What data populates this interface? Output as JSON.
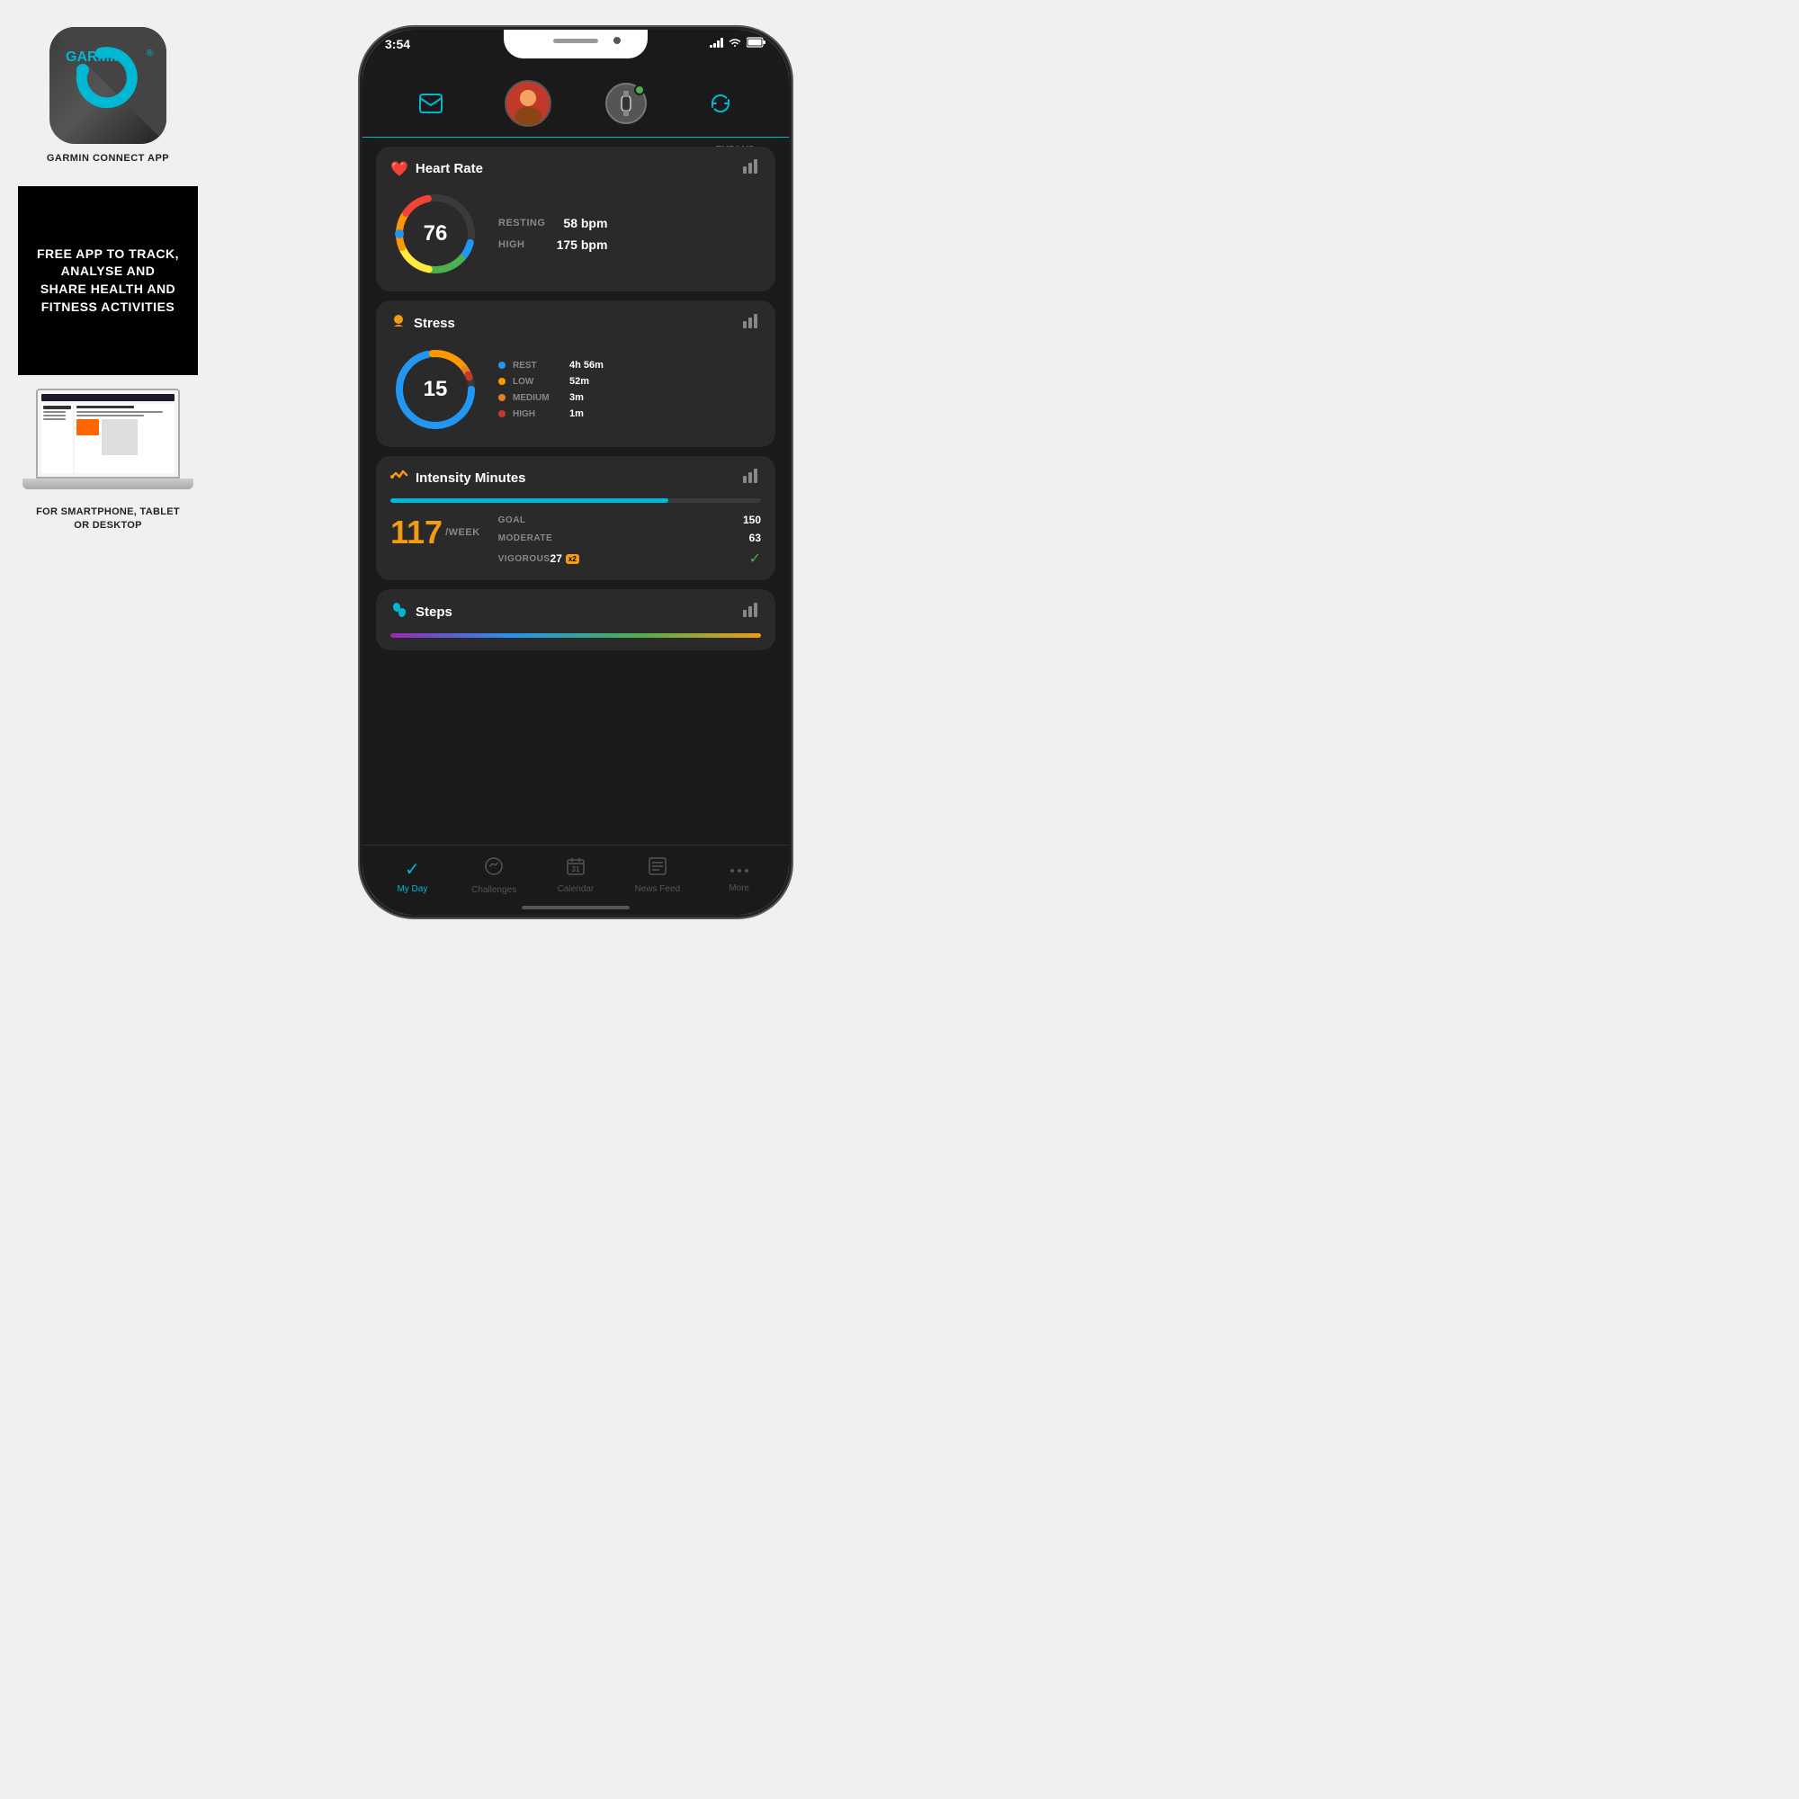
{
  "app": {
    "title": "GARMIN CONNECT APP"
  },
  "promo": {
    "text": "FREE APP TO TRACK, ANALYSE AND SHARE HEALTH AND FITNESS ACTIVITIES"
  },
  "laptop": {
    "caption": "FOR SMARTPHONE, TABLET\nOR DESKTOP"
  },
  "status_bar": {
    "time": "3:54"
  },
  "header": {
    "expand_label": "EXPAND"
  },
  "heart_rate": {
    "title": "Heart Rate",
    "value": "76",
    "resting_label": "RESTING",
    "resting_value": "58 bpm",
    "high_label": "HIGH",
    "high_value": "175 bpm"
  },
  "stress": {
    "title": "Stress",
    "value": "15",
    "rest_label": "REST",
    "rest_value": "4h 56m",
    "low_label": "LOW",
    "low_value": "52m",
    "medium_label": "MEDIUM",
    "medium_value": "3m",
    "high_label": "HIGH",
    "high_value": "1m"
  },
  "intensity": {
    "title": "Intensity Minutes",
    "value": "117",
    "unit": "/WEEK",
    "goal_label": "GOAL",
    "goal_value": "150",
    "moderate_label": "MODERATE",
    "moderate_value": "63",
    "vigorous_label": "VIGOROUS",
    "vigorous_value": "27",
    "x2_badge": "x2"
  },
  "steps": {
    "title": "Steps"
  },
  "nav": {
    "my_day": "My Day",
    "challenges": "Challenges",
    "calendar": "Calendar",
    "news_feed": "News Feed",
    "more": "More"
  }
}
